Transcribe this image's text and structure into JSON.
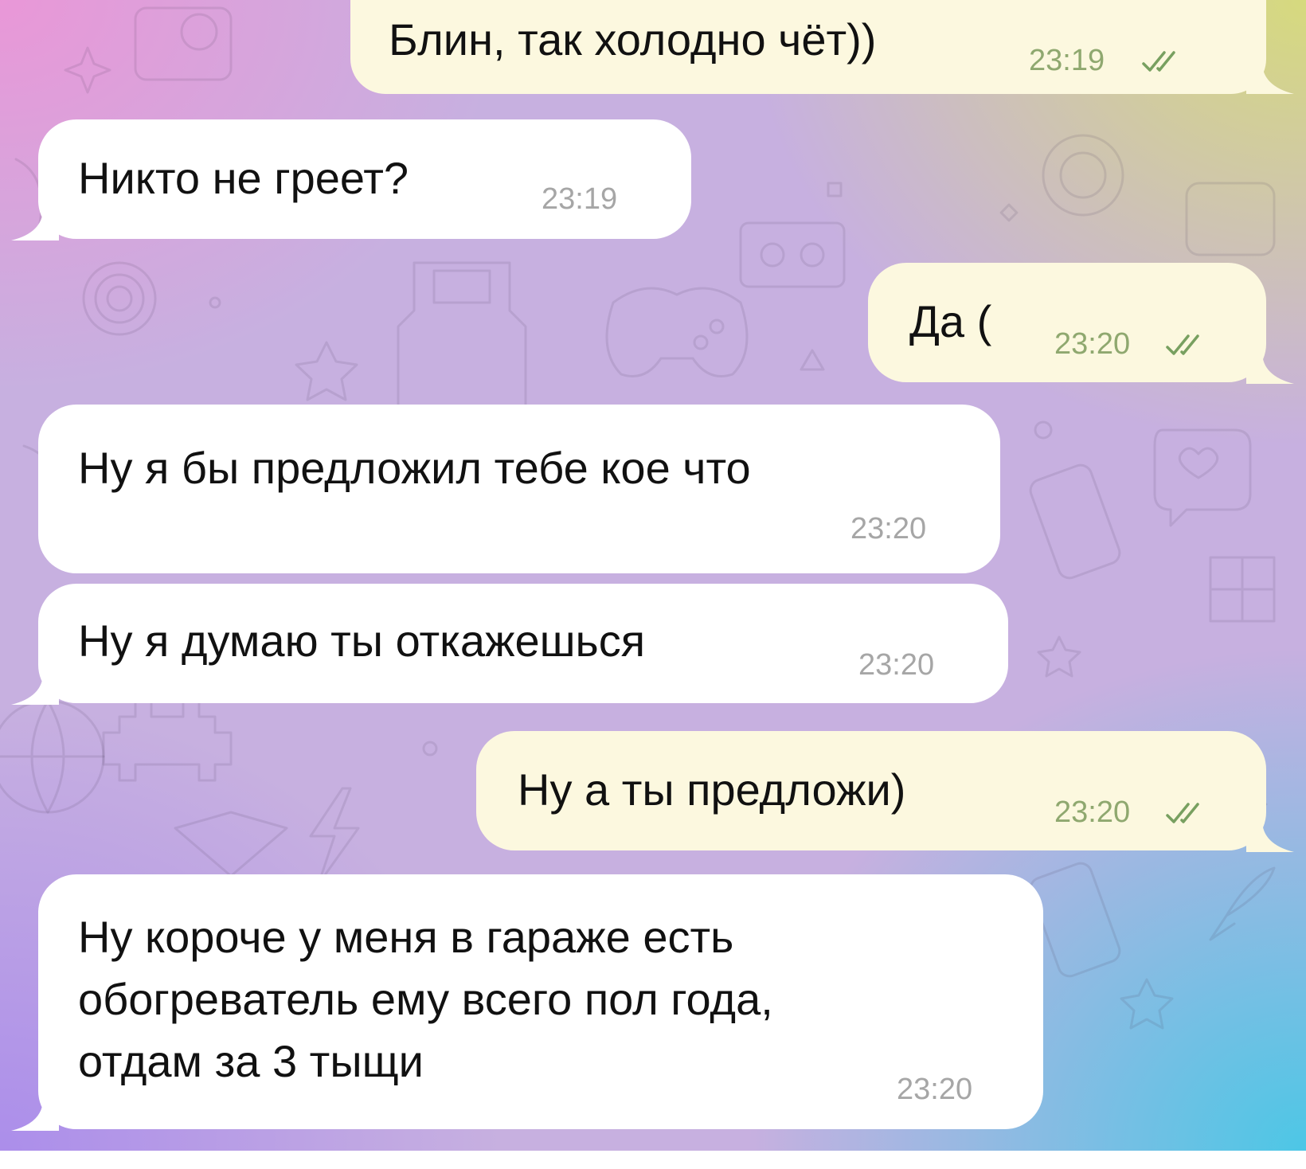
{
  "chat": {
    "background_colors": [
      "#eb96d7",
      "#d7dc78",
      "#46c8e6",
      "#aa8ceb"
    ],
    "outgoing_bubble_color": "#fcf8df",
    "incoming_bubble_color": "#ffffff",
    "read_status_icon": "double-check-icon",
    "messages": [
      {
        "direction": "out",
        "text": "Блин, так холодно чёт))",
        "time": "23:19",
        "status": "read"
      },
      {
        "direction": "in",
        "text": "Никто не греет?",
        "time": "23:19"
      },
      {
        "direction": "out",
        "text": "Да (",
        "time": "23:20",
        "status": "read"
      },
      {
        "direction": "in",
        "text": "Ну я бы предложил тебе кое что",
        "time": "23:20"
      },
      {
        "direction": "in",
        "text": "Ну я думаю ты откажешься",
        "time": "23:20"
      },
      {
        "direction": "out",
        "text": "Ну а ты предложи)",
        "time": "23:20",
        "status": "read"
      },
      {
        "direction": "in",
        "text": "Ну короче у меня в гараже есть\nобогреватель ему всего пол года,\nотдам за 3 тыщи",
        "time": "23:20"
      }
    ]
  }
}
